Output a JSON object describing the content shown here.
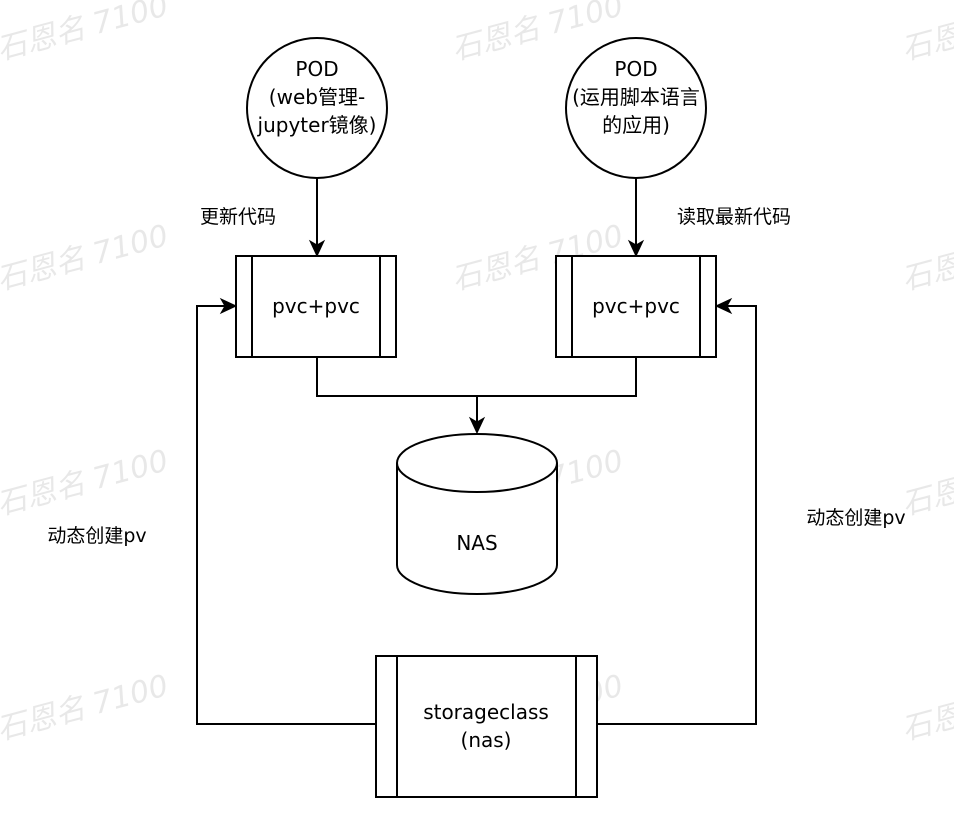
{
  "watermark": "石恩名 7100",
  "watermark_partial": "石恩",
  "nodes": {
    "pod_left": {
      "lines": [
        "POD",
        "(web管理-",
        "jupyter镜像)"
      ]
    },
    "pod_right": {
      "lines": [
        "POD",
        "(运用脚本语言",
        "的应用)"
      ]
    },
    "pvc_left": {
      "label": "pvc+pvc"
    },
    "pvc_right": {
      "label": "pvc+pvc"
    },
    "nas": {
      "label": "NAS"
    },
    "storageclass": {
      "lines": [
        "storageclass",
        "(nas)"
      ]
    }
  },
  "edge_labels": {
    "update_code": "更新代码",
    "read_latest_code": "读取最新代码",
    "dynamic_pv_left": "动态创建pv",
    "dynamic_pv_right": "动态创建pv"
  }
}
